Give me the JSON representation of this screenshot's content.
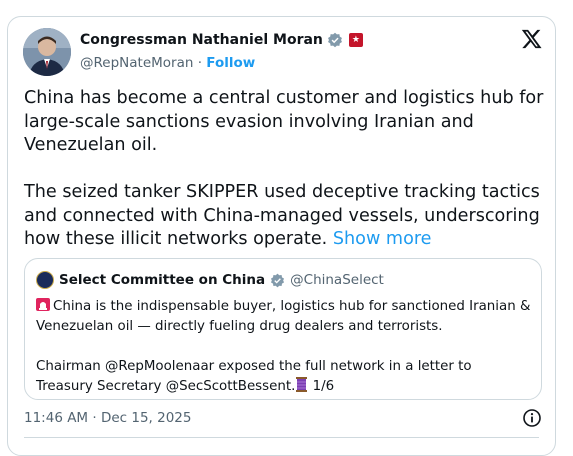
{
  "author": {
    "name": "Congressman Nathaniel Moran",
    "handle": "@RepNateMoran",
    "separator": "·",
    "follow_label": "Follow",
    "avatar_icon": "avatar-photo",
    "verified_icon": "verified-badge-gray",
    "affiliation_icon": "congress-flag"
  },
  "platform_icon": "x-logo",
  "post": {
    "text": "China has become a central customer and logistics hub for large-scale sanctions evasion involving Iranian and Venezuelan oil.\n\nThe seized tanker SKIPPER used deceptive tracking tactics and connected with China-managed vessels, underscoring how these illicit networks operate.",
    "show_more_label": "Show more"
  },
  "quote": {
    "name": "Select Committee on China",
    "handle": "@ChinaSelect",
    "verified_icon": "verified-badge-gold",
    "line1": "China is the indispensable buyer, logistics hub for sanctioned Iranian & Venezuelan oil — directly fueling drug dealers and terrorists.",
    "line2": "Chairman @RepMoolenaar exposed the full network in a letter to Treasury Secretary @SecScottBessent.",
    "line2_suffix": " 1/6",
    "siren_icon": "siren-emoji",
    "thread_icon": "thread-emoji"
  },
  "timestamp": "11:46 AM · Dec 15, 2025",
  "info_icon": "info-icon",
  "colors": {
    "link": "#1d9bf0",
    "secondary_text": "#536471",
    "border": "#cfd9de"
  }
}
